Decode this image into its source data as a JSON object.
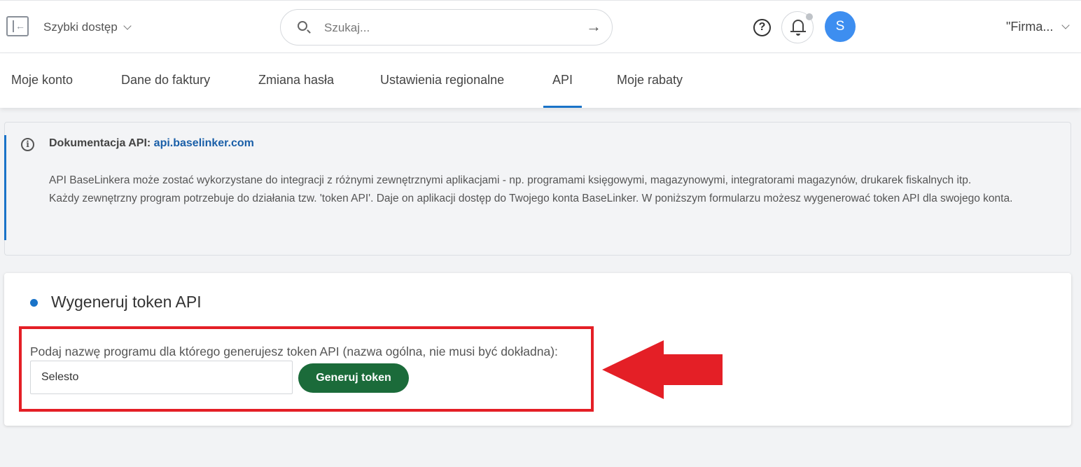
{
  "header": {
    "quick_access": "Szybki dostęp",
    "search_placeholder": "Szukaj...",
    "help_glyph": "?",
    "avatar_initial": "S",
    "company": "\"Firma..."
  },
  "tabs": [
    {
      "label": "Moje konto",
      "active": false
    },
    {
      "label": "Dane do faktury",
      "active": false
    },
    {
      "label": "Zmiana hasła",
      "active": false
    },
    {
      "label": "Ustawienia regionalne",
      "active": false
    },
    {
      "label": "API",
      "active": true
    },
    {
      "label": "Moje rabaty",
      "active": false
    }
  ],
  "info": {
    "doc_label": "Dokumentacja API:",
    "doc_link": "api.baselinker.com",
    "paragraph1": "API BaseLinkera może zostać wykorzystane do integracji z różnymi zewnętrznymi aplikacjami - np. programami księgowymi, magazynowymi, integratorami magazynów, drukarek fiskalnych itp.",
    "paragraph2": "Każdy zewnętrzny program potrzebuje do działania tzw. 'token API'. Daje on aplikacji dostęp do Twojego konta BaseLinker. W poniższym formularzu możesz wygenerować token API dla swojego konta."
  },
  "card": {
    "title": "Wygeneruj token API",
    "field_label": "Podaj nazwę programu dla którego generujesz token API (nazwa ogólna, nie musi być dokładna):",
    "field_value": "Selesto",
    "button_label": "Generuj token"
  },
  "colors": {
    "accent": "#1a73c8",
    "button": "#1b6b3a",
    "annotation": "#e41f26",
    "avatar": "#3d8ef0"
  }
}
